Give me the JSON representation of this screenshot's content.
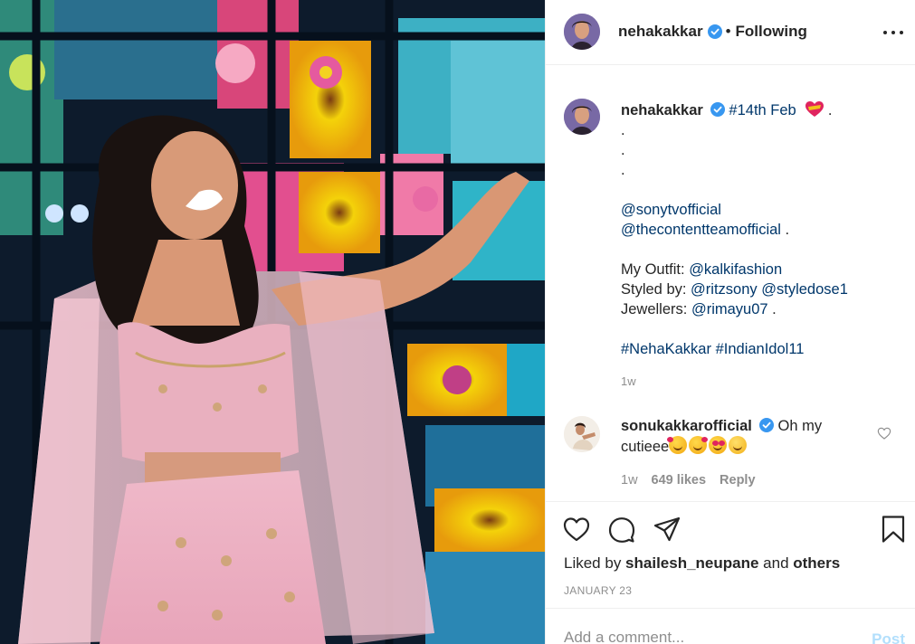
{
  "post": {
    "author": "nehakakkar",
    "follow_state": "Following",
    "separator": "•",
    "caption": {
      "user": "nehakakkar",
      "hashtag_intro": "#14th Feb",
      "intro_suffix": " .",
      "dots": [
        ".",
        ".",
        "."
      ],
      "mentions": [
        "@sonytvofficial",
        "@thecontentteamofficial"
      ],
      "mention_suffix": " .",
      "outfit_label": "My Outfit: ",
      "outfit_handle": "@kalkifashion",
      "styled_label": "Styled by: ",
      "styled_handles": [
        "@ritzsony",
        "@styledose1"
      ],
      "jewellers_label": "Jewellers: ",
      "jewellers_handle": "@rimayu07",
      "jewellers_suffix": " .",
      "hashtags": [
        "#NehaKakkar",
        "#IndianIdol11"
      ],
      "time": "1w"
    },
    "comments": [
      {
        "user": "sonukakkarofficial",
        "text_line1": "Oh my",
        "text_line2": "cutieee",
        "emojis": [
          "smiling-face-with-hearts-emoji",
          "smiling-face-with-hearts-emoji",
          "heart-eyes-emoji",
          "smiling-face-emoji"
        ],
        "time": "1w",
        "likes": "649 likes",
        "reply_label": "Reply"
      }
    ],
    "liked_by_prefix": "Liked by ",
    "liked_by_user": "shailesh_neupane",
    "liked_by_middle": " and ",
    "liked_by_suffix": "others",
    "date": "JANUARY 23"
  },
  "add_comment": {
    "placeholder": "Add a comment...",
    "post_label": "Post"
  },
  "colors": {
    "link": "#00376b",
    "verified": "#3897f0",
    "muted": "#8e8e8e",
    "post_disabled": "#b2dffc",
    "heart_emoji": "#e0245e"
  }
}
